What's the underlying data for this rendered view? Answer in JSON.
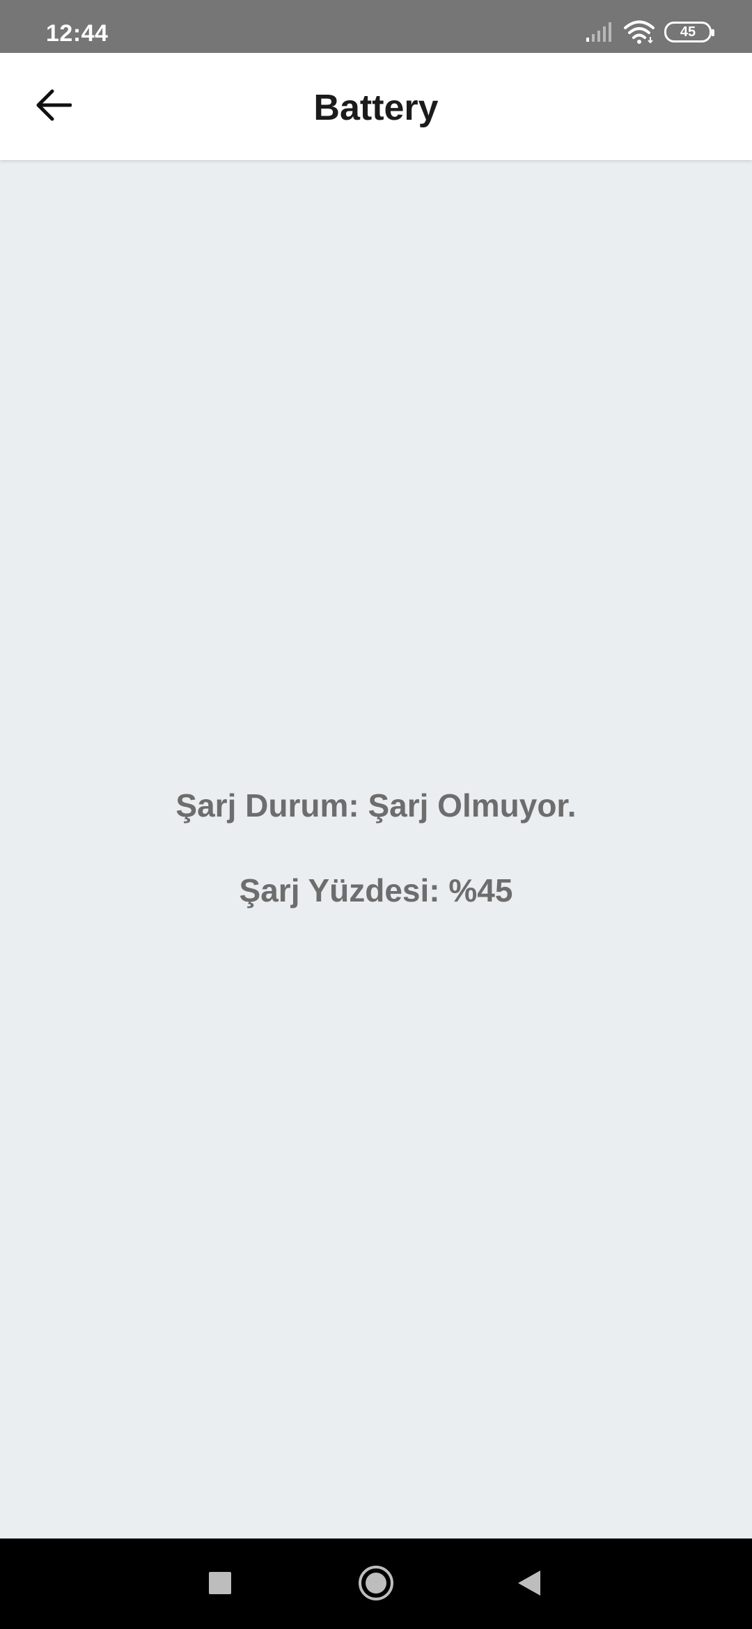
{
  "status_bar": {
    "time": "12:44",
    "battery_level": "45",
    "icons": [
      "signal-icon",
      "wifi-icon",
      "battery-icon"
    ]
  },
  "app_bar": {
    "title": "Battery",
    "back_icon": "arrow-left-icon"
  },
  "battery_info": {
    "charge_status": "Şarj Durum: Şarj Olmuyor.",
    "charge_percent": "Şarj Yüzdesi: %45"
  },
  "nav_bar": {
    "icons": [
      "recents-square-icon",
      "home-circle-icon",
      "back-triangle-icon"
    ]
  },
  "colors": {
    "status_bar_bg": "#767676",
    "app_bar_bg": "#ffffff",
    "content_bg": "#eaeef0",
    "info_text": "#6d6d6d",
    "nav_bar_bg": "#000000"
  }
}
